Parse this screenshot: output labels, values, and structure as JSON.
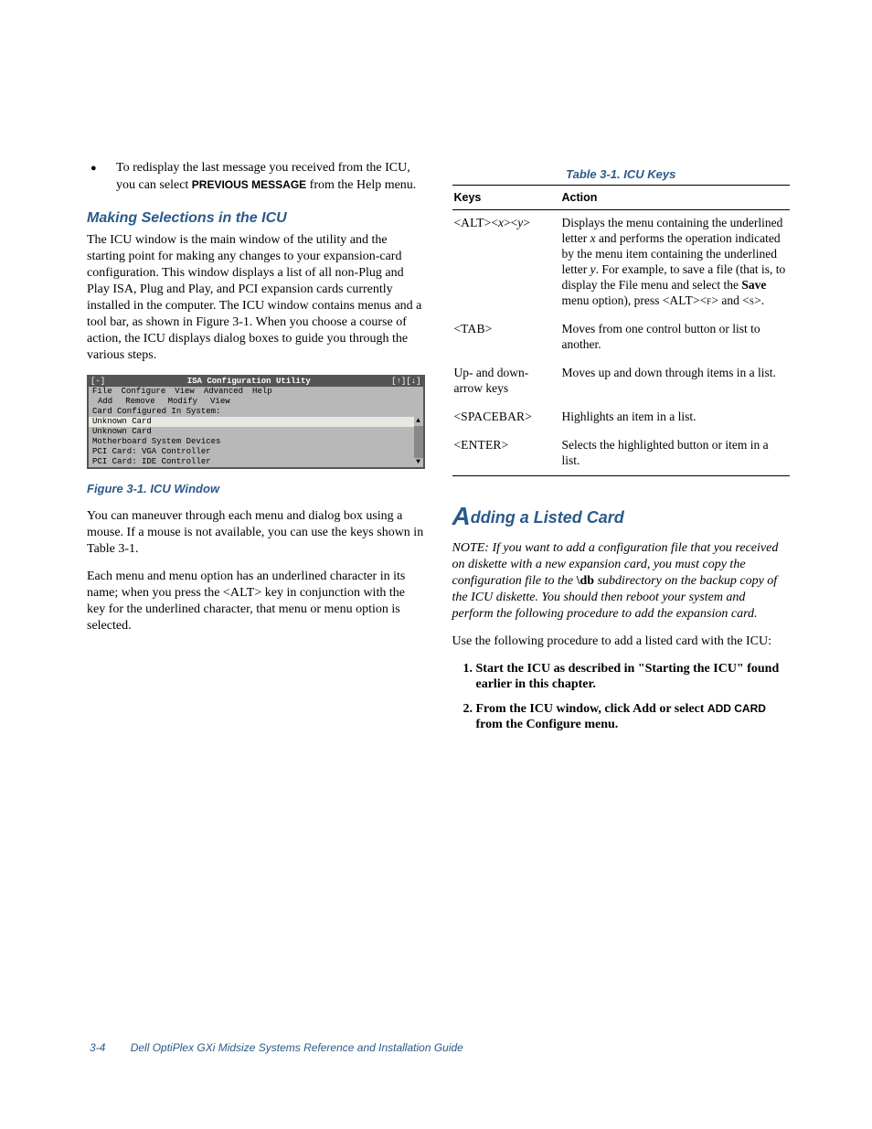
{
  "leftCol": {
    "bullet": {
      "pre": "To redisplay the last message you received from the ICU, you can select ",
      "bold": "PREVIOUS MESSAGE",
      "post": " from the Help menu."
    },
    "subhead": "Making Selections in the ICU",
    "para1": "The ICU window is the main window of the utility and the starting point for making any changes to your expansion-card configuration. This window displays a list of all non-Plug and Play ISA, Plug and Play, and PCI expansion cards currently installed in the computer. The ICU window contains menus and a tool bar, as shown in Figure 3-1. When you choose a course of action, the ICU displays dialog boxes to guide you through the various steps.",
    "figure": {
      "titleLeft": "[-]",
      "titleCenter": "ISA Configuration Utility",
      "titleRight": "[↑][↓]",
      "menubar": [
        "File",
        "Configure",
        "View",
        "Advanced",
        "Help"
      ],
      "toolbar": [
        "Add",
        "Remove",
        "Modify",
        "View"
      ],
      "label": "Card Configured In System:",
      "rows": [
        {
          "t": "Unknown Card",
          "sel": true
        },
        {
          "t": "Unknown Card",
          "sel": false
        },
        {
          "t": "Motherboard System Devices",
          "sel": false
        },
        {
          "t": "PCI Card: VGA Controller",
          "sel": false
        },
        {
          "t": "PCI Card: IDE Controller",
          "sel": false
        }
      ]
    },
    "caption": "Figure 3-1.  ICU Window",
    "para2": "You can maneuver through each menu and dialog box using a mouse. If a mouse is not available, you can use the keys shown in Table 3-1.",
    "para3_pre": "Each menu and menu option has an underlined character in its name; when you press the <",
    "para3_key": "ALT",
    "para3_post": "> key in conjunction with the key for the underlined character, that menu or menu option is selected."
  },
  "rightCol": {
    "tableCaption": "Table 3-1.  ICU Keys",
    "headers": {
      "k": "Keys",
      "a": "Action"
    },
    "rows": [
      {
        "keyHtml": "<<span class='sc'>ALT</span>><<i>x</i>><<i>y</i>>",
        "actHtml": "Displays the menu containing the underlined letter <i>x</i> and performs the operation indicated by the menu item containing the underlined letter <i>y</i>. For example, to save a file (that is, to display the File menu and select the <b>Save</b> menu option), press <<span class='sc'>ALT</span>><<span class='sc'>f</span>> and <<span class='sc'>s</span>>."
      },
      {
        "keyHtml": "<<span class='sc'>TAB</span>>",
        "actHtml": "Moves from one control button or list to another."
      },
      {
        "keyHtml": "Up- and down-arrow keys",
        "actHtml": "Moves up and down through items in a list."
      },
      {
        "keyHtml": "<<span class='sc'>SPACEBAR</span>>",
        "actHtml": "Highlights an item in a list."
      },
      {
        "keyHtml": "<<span class='sc'>ENTER</span>>",
        "actHtml": "Selects the highlighted button or item in a list."
      }
    ],
    "sectionBig": "A",
    "sectionRest": "dding a Listed Card",
    "note_pre": "NOTE: If you want to add a configuration file that you received on diskette with a new expansion card, you must copy the configuration file to the ",
    "note_bold": "\\db",
    "note_post": " subdirectory on the backup copy of the ICU diskette. You should then reboot your system and perform the following procedure to add the expansion card.",
    "para": "Use the following procedure to add a listed card with the ICU:",
    "step1": "Start the ICU as described in \"Starting the ICU\" found earlier in this chapter.",
    "step2_pre": "From the ICU window, click Add or select ",
    "step2_bold": "ADD CARD",
    "step2_post": " from the Configure menu."
  },
  "footer": {
    "page": "3-4",
    "title": "Dell OptiPlex GXi Midsize Systems Reference and Installation Guide"
  }
}
